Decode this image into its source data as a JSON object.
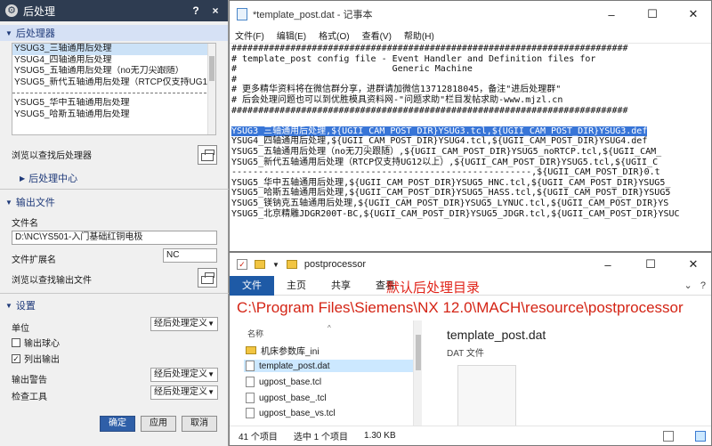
{
  "nx_dialog": {
    "title": "后处理",
    "help_icon": "?",
    "close_icon": "×",
    "postprocessor_section": "后处理器",
    "postprocessors": [
      "YSUG3_三轴通用后处理",
      "YSUG4_四轴通用后处理",
      "YSUG5_五轴通用后处理（no无刀尖跟随）",
      "YSUG5_新代五轴通用后处理（RTCP仅支持UG12以上）",
      "YSUG5_华中五轴通用后处理",
      "YSUG5_哈斯五轴通用后处理"
    ],
    "browse_post_label": "浏览以查找后处理器",
    "post_center_label": "后处理中心",
    "output_section": "输出文件",
    "filename_label": "文件名",
    "filename_value": "D:\\NC\\YS501-入门基础红铜电极",
    "ext_label": "文件扩展名",
    "ext_value": "NC",
    "browse_output_label": "浏览以查找输出文件",
    "settings_section": "设置",
    "unit_label": "单位",
    "unit_value": "经后处理定义",
    "output_ball_label": "输出球心",
    "list_output_label": "列出输出",
    "list_output_checkmark": "✓",
    "output_warning_label": "输出警告",
    "output_warning_value": "经后处理定义",
    "check_tool_label": "检查工具",
    "check_tool_value": "经后处理定义",
    "ok": "确定",
    "apply": "应用",
    "cancel": "取消"
  },
  "notepad": {
    "title": "*template_post.dat - 记事本",
    "min_icon": "–",
    "max_icon": "☐",
    "close_icon": "✕",
    "menu": [
      "文件(F)",
      "编辑(E)",
      "格式(O)",
      "查看(V)",
      "帮助(H)"
    ],
    "lines": [
      "##########################################################################",
      "# template_post config file - Event Handler and Definition files for",
      "#                             Generic Machine",
      "#",
      "# 更多精华资料将在微信群分享，进群请加微信13712818045，备注\"进后处理群\"",
      "# 后会处理问题也可以到优胜模具资料网-\"问题求助\"栏目发帖求助-www.mjzl.cn",
      "##########################################################################",
      "",
      "YSUG3_三轴通用后处理,${UGII_CAM_POST_DIR}YSUG3.tcl,${UGII_CAM_POST_DIR}YSUG3.def",
      "YSUG4_四轴通用后处理,${UGII_CAM_POST_DIR}YSUG4.tcl,${UGII_CAM_POST_DIR}YSUG4.def",
      "YSUG5_五轴通用后处理（no无刀尖跟随）,${UGII_CAM_POST_DIR}YSUG5_noRTCP.tcl,${UGII_CAM_",
      "YSUG5_新代五轴通用后处理（RTCP仅支持UG12以上）,${UGII_CAM_POST_DIR}YSUG5.tcl,${UGII_C",
      "--------------------------------------------------------,${UGII_CAM_POST_DIR}0.t",
      "YSUG5_华中五轴通用后处理,${UGII_CAM_POST_DIR}YSUG5_HNC.tcl,${UGII_CAM_POST_DIR}YSUG5_",
      "YSUG5_哈斯五轴通用后处理,${UGII_CAM_POST_DIR}YSUG5_HASS.tcl,${UGII_CAM_POST_DIR}YSUG5",
      "YSUG5_镁钠克五轴通用后处理,${UGII_CAM_POST_DIR}YSUG5_LYNUC.tcl,${UGII_CAM_POST_DIR}YS",
      "YSUG5_北京精雕JDGR200T-BC,${UGII_CAM_POST_DIR}YSUG5_JDGR.tcl,${UGII_CAM_POST_DIR}YSUC"
    ]
  },
  "explorer": {
    "title": "postprocessor",
    "min_icon": "–",
    "max_icon": "☐",
    "close_icon": "✕",
    "tabs": [
      "文件",
      "主页",
      "共享",
      "查看"
    ],
    "ribbon_note": "默认后处理目录",
    "ribbon_chevron": "⌄",
    "ribbon_help": "?",
    "path": "C:\\Program Files\\Siemens\\NX 12.0\\MACH\\resource\\postprocessor",
    "col_name": "名称",
    "sort_indicator": "^",
    "files": [
      "机床参数库_ini",
      "template_post.dat",
      "ugpost_base.tcl",
      "ugpost_base_.tcl",
      "ugpost_base_vs.tcl"
    ],
    "preview_name": "template_post.dat",
    "preview_type": "DAT 文件",
    "status_count": "41 个项目",
    "status_selected": "选中 1 个项目",
    "status_size": "1.30 KB",
    "colors": {
      "file_tab": "#1e5aa6",
      "path": "#d42415",
      "annotation": "#e0241a",
      "highlight": "#3875d7"
    }
  }
}
